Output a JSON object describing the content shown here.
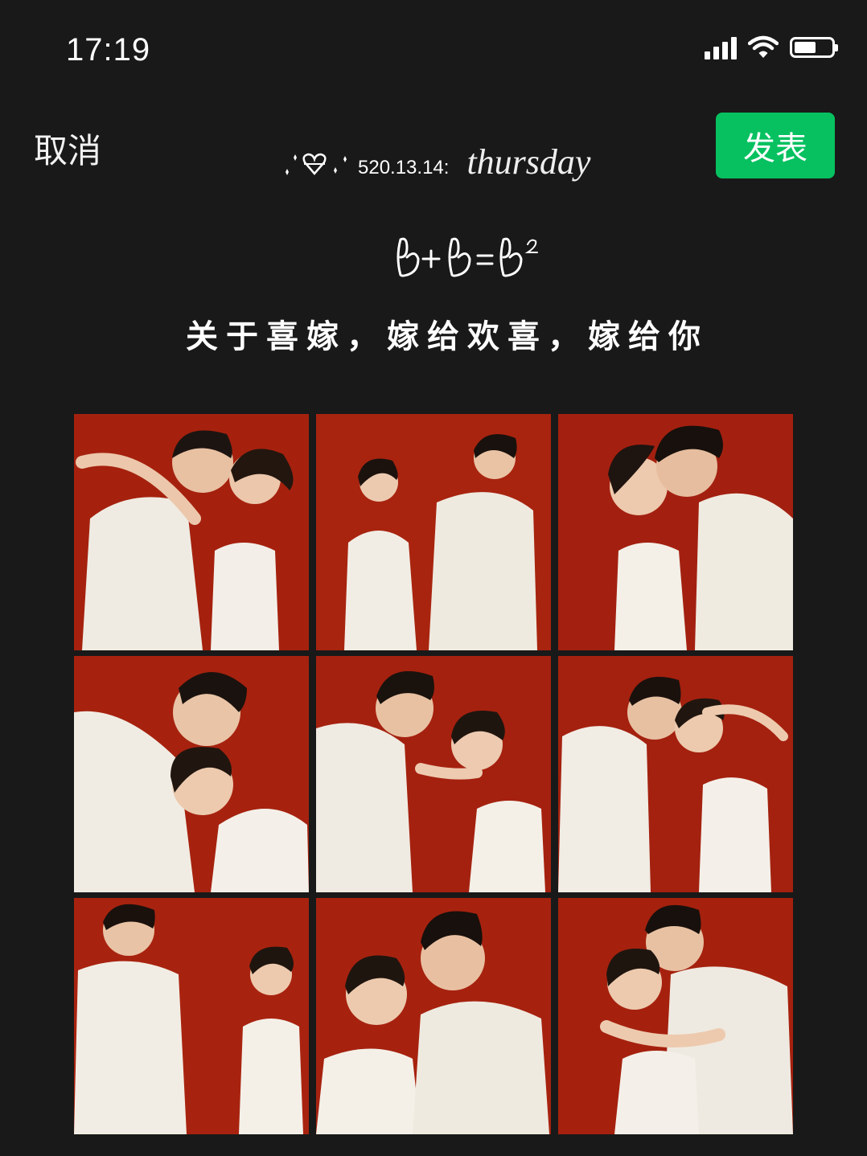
{
  "status_bar": {
    "time": "17:19"
  },
  "header": {
    "cancel_label": "取消",
    "publish_label": "发表"
  },
  "post": {
    "tagline_code": "520.13.14:",
    "tagline_word": "thursday",
    "headline": "关于喜嫁，嫁给欢喜，嫁给你"
  },
  "colors": {
    "publish_green": "#07c160",
    "background": "#191919",
    "photo_red": "#a8220f"
  },
  "photos": [
    {
      "name": "photo-1",
      "desc": "couple embracing foreheads touching"
    },
    {
      "name": "photo-2",
      "desc": "couple standing pointing"
    },
    {
      "name": "photo-3",
      "desc": "couple cheek to cheek laughing"
    },
    {
      "name": "photo-4",
      "desc": "couple leaning heads together"
    },
    {
      "name": "photo-5",
      "desc": "couple blowing kisses"
    },
    {
      "name": "photo-6",
      "desc": "couple saluting"
    },
    {
      "name": "photo-7",
      "desc": "couple standing apart smiling"
    },
    {
      "name": "photo-8",
      "desc": "couple laughing covering mouths"
    },
    {
      "name": "photo-9",
      "desc": "bride hugging groom from behind"
    }
  ]
}
